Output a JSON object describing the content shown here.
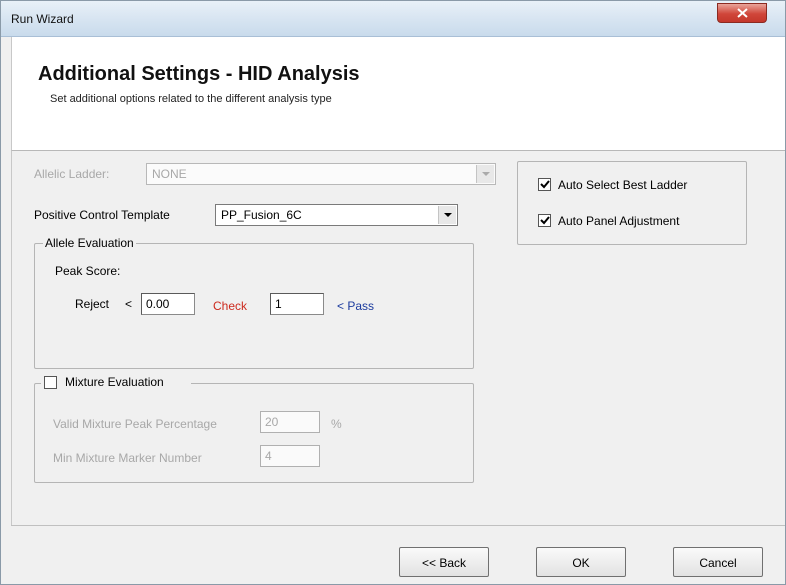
{
  "window": {
    "title": "Run Wizard",
    "close_glyph": "✕"
  },
  "header": {
    "title": "Additional Settings - HID Analysis",
    "subtitle": "Set additional options related to the different analysis type"
  },
  "allelic_ladder": {
    "label": "Allelic Ladder:",
    "value": "NONE"
  },
  "positive_control": {
    "label": "Positive Control Template",
    "value": "PP_Fusion_6C"
  },
  "allele_evaluation": {
    "title": "Allele Evaluation",
    "peak_score_label": "Peak Score:",
    "reject_label": "Reject",
    "lt1": "<",
    "reject_value": "0.00",
    "check_label": "Check",
    "check_value": "1",
    "pass_label": "< Pass",
    "colors": {
      "check": "#cc2a1e",
      "pass": "#1a3a9e"
    }
  },
  "mixture_evaluation": {
    "title": "Mixture Evaluation",
    "checked": false,
    "peak_pct_label": "Valid Mixture Peak Percentage",
    "peak_pct_value": "20",
    "pct_unit": "%",
    "marker_label": "Min Mixture Marker Number",
    "marker_value": "4"
  },
  "options": {
    "auto_select": {
      "label": "Auto Select Best Ladder",
      "checked": true
    },
    "auto_panel": {
      "label": "Auto Panel Adjustment",
      "checked": true
    }
  },
  "buttons": {
    "back": "<< Back",
    "ok": "OK",
    "cancel": "Cancel"
  }
}
